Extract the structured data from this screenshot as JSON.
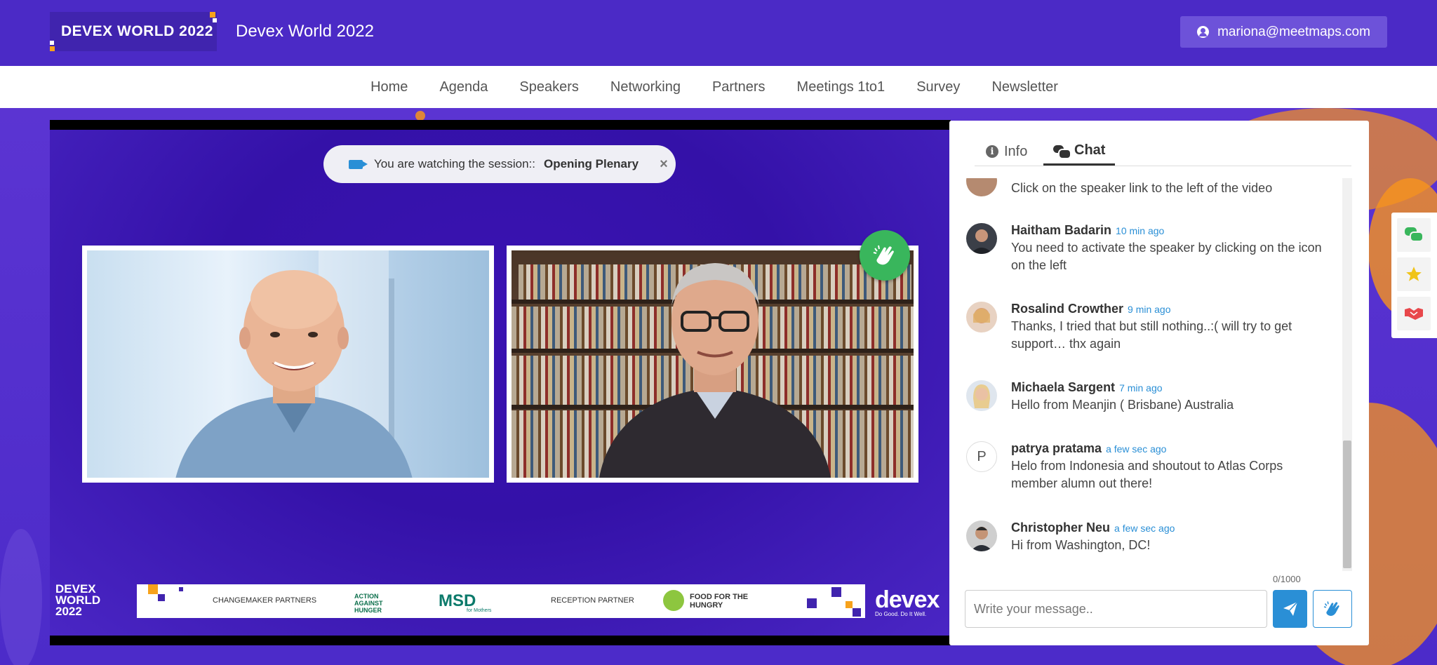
{
  "header": {
    "logo_text": "DEVEX WORLD 2022",
    "event_title": "Devex World 2022",
    "user_email": "mariona@meetmaps.com",
    "user_icon": "user-circle-icon"
  },
  "nav": {
    "items": [
      "Home",
      "Agenda",
      "Speakers",
      "Networking",
      "Partners",
      "Meetings 1to1",
      "Survey",
      "Newsletter"
    ]
  },
  "video": {
    "session_prefix": "You are watching the session::",
    "session_name": "Opening Plenary",
    "close_symbol": "×",
    "camera_icon": "video-camera-icon",
    "applause_icon": "clapping-hands-icon"
  },
  "sponsors": {
    "logo_text_1": "DEVEX",
    "logo_text_2": "WORLD",
    "logo_text_3": "2022",
    "changemaker_label": "CHANGEMAKER PARTNERS",
    "partner_1": "ACTION AGAINST HUNGER",
    "partner_2": "MSD",
    "partner_2_sub": "for Mothers",
    "reception_label": "RECEPTION PARTNER",
    "partner_3": "FOOD FOR THE HUNGRY",
    "devex_logo": "devex",
    "devex_tagline": "Do Good. Do It Well."
  },
  "panel": {
    "tabs": [
      {
        "label": "Info",
        "icon": "info-circle-icon",
        "active": false
      },
      {
        "label": "Chat",
        "icon": "comments-icon",
        "active": true
      }
    ],
    "messages": [
      {
        "name": "",
        "time": "",
        "text": "Click on the speaker link to the left of the video"
      },
      {
        "name": "Haitham Badarin",
        "time": "10 min ago",
        "text": "You need to activate the speaker by clicking on the icon on the left"
      },
      {
        "name": "Rosalind Crowther",
        "time": "9 min ago",
        "text": "Thanks, I tried that but still nothing..:( will try to get support… thx again"
      },
      {
        "name": "Michaela Sargent",
        "time": "7 min ago",
        "text": "Hello from Meanjin ( Brisbane) Australia"
      },
      {
        "name": "patrya pratama",
        "time": "a few sec ago",
        "text": "Helo from Indonesia and shoutout to Atlas Corps member alumn out there!",
        "avatar_letter": "P"
      },
      {
        "name": "Christopher Neu",
        "time": "a few sec ago",
        "text": "Hi from Washington, DC!"
      }
    ],
    "char_counter": "0/1000",
    "input_placeholder": "Write your message..",
    "send_icon": "paper-plane-icon",
    "applause_icon": "clapping-hands-icon"
  },
  "right_bar": {
    "icons": [
      "comments-icon",
      "star-icon",
      "handshake-icon"
    ]
  },
  "colors": {
    "brand_purple": "#4b2ac6",
    "accent_orange": "#f7941d",
    "link_blue": "#2a8fd6",
    "applause_green": "#39b65c"
  }
}
